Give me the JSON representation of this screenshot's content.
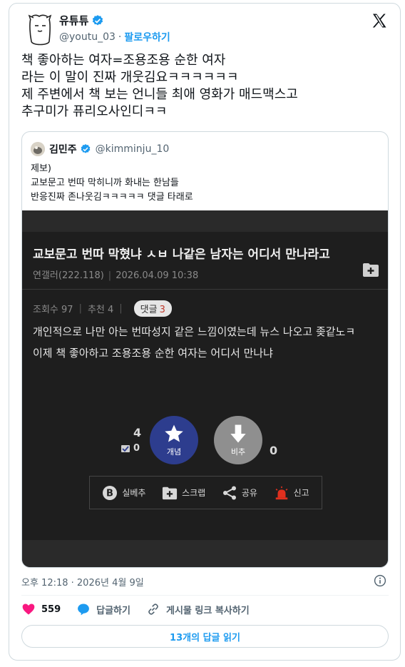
{
  "author": {
    "name": "유튜튜",
    "handle": "@youtu_03",
    "separator": "·",
    "follow_label": "팔로우하기"
  },
  "tweet": {
    "lines": [
      "책 좋아하는 여자=조용조용 순한 여자",
      "라는 이 말이 진짜 개웃김요ㅋㅋㅋㅋㅋㅋ",
      "제 주변에서 책 보는 언니들 최애 영화가 매드맥스고",
      "추구미가 퓨리오사인디ㅋㅋ"
    ]
  },
  "quote": {
    "name": "김민주",
    "handle": "@kimminju_10",
    "lines": [
      "제보)",
      "교보문고 번따 막히니까 화내는 한남들",
      "반응진짜 존나웃김ㅋㅋㅋㅋㅋ 댓글 타래로"
    ],
    "post": {
      "title": "교보문고 번따 막혔냐 ㅅㅂ 나같은 남자는 어디서 만나라고",
      "author": "연갤러(222.118)",
      "date": "2026.04.09 10:38",
      "views": "조회수 97",
      "recommends": "추천 4",
      "reply_label": "댓글",
      "reply_count": "3",
      "body": [
        "개인적으로 나만 아는 번따성지 같은 느낌이였는데 뉴스 나오고 좆같노ㅋ",
        "이제 책 좋아하고 조용조용 순한 여자는 어디서 만나냐"
      ],
      "upvote_count": "4",
      "fixed_count": "0",
      "upvote_label": "개념",
      "downvote_label": "비추",
      "downvote_count": "0",
      "actions": [
        "실베추",
        "스크랩",
        "공유",
        "신고"
      ]
    }
  },
  "footer": {
    "timestamp": "오후 12:18 · 2026년 4월 9일",
    "likes": "559",
    "reply_label": "답글하기",
    "copy_link_label": "게시물 링크 복사하기",
    "read_replies_label": "13개의 답글 읽기"
  },
  "colors": {
    "accent": "#1d9bf0",
    "like": "#f91880",
    "upvote": "#2d3d8e",
    "downvote": "#8f8f8f",
    "report": "#e0301e"
  },
  "icons": [
    "avatar-icon",
    "verified-icon",
    "x-logo-icon",
    "add-icon",
    "star-icon",
    "arrow-down-icon",
    "best-icon",
    "scrap-icon",
    "share-icon",
    "siren-icon",
    "info-icon",
    "heart-icon",
    "reply-icon",
    "link-icon"
  ]
}
